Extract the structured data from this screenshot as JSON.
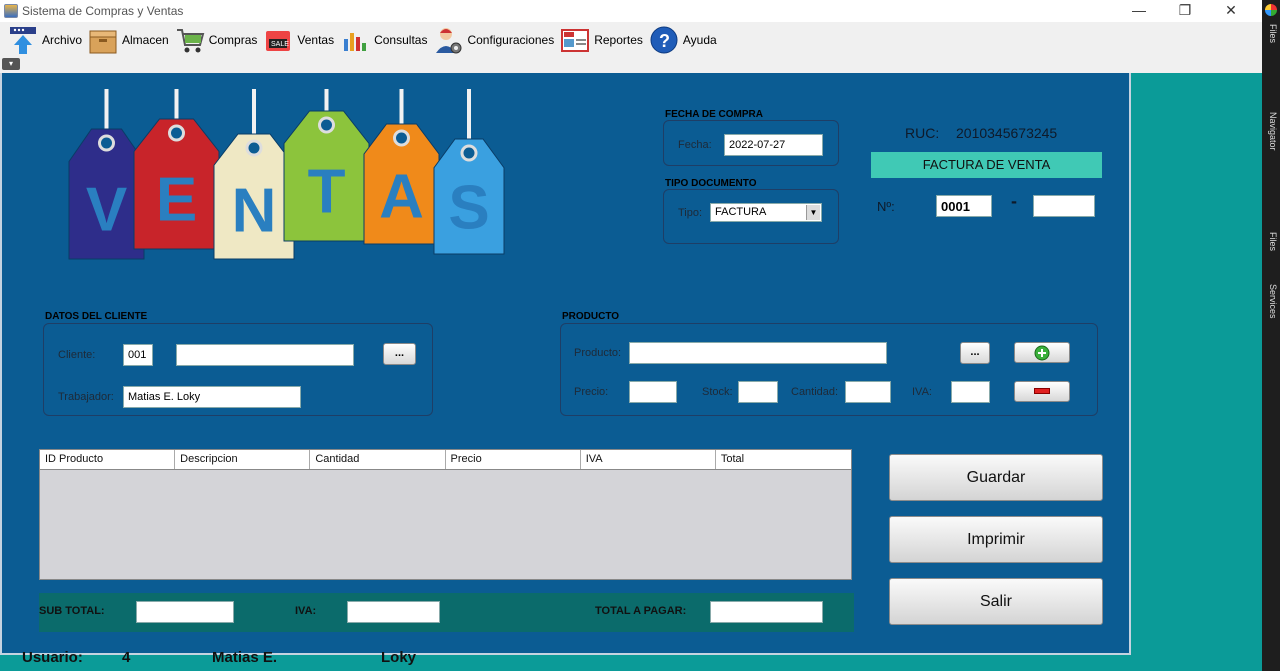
{
  "window": {
    "title": "Sistema de Compras y Ventas",
    "controls": [
      "—",
      "❐",
      "✕"
    ]
  },
  "menu": [
    {
      "label": "Archivo",
      "icon": "upload-icon"
    },
    {
      "label": "Almacen",
      "icon": "box-icon"
    },
    {
      "label": "Compras",
      "icon": "cart-icon"
    },
    {
      "label": "Ventas",
      "icon": "sale-icon"
    },
    {
      "label": "Consultas",
      "icon": "chart-icon"
    },
    {
      "label": "Configuraciones",
      "icon": "user-gear-icon"
    },
    {
      "label": "Reportes",
      "icon": "news-icon"
    },
    {
      "label": "Ayuda",
      "icon": "help-icon"
    }
  ],
  "ide_side": {
    "labels": [
      "Files",
      "Navigator",
      "Files",
      "Services"
    ]
  },
  "logo": {
    "text": "VENTAS",
    "letters": [
      "V",
      "E",
      "N",
      "T",
      "A",
      "S"
    ],
    "tag_colors": [
      "#2e2d8a",
      "#c8242a",
      "#efe8c4",
      "#8cc43c",
      "#f08a1a",
      "#3aa0e0"
    ]
  },
  "fecha": {
    "group_label": "FECHA DE COMPRA",
    "label": "Fecha:",
    "value": "2022-07-27"
  },
  "tipo": {
    "group_label": "TIPO DOCUMENTO",
    "label": "Tipo:",
    "value": "FACTURA"
  },
  "ruc": {
    "label": "RUC:",
    "value": "2010345673245"
  },
  "factura": {
    "title": "FACTURA DE VENTA",
    "num_label": "Nº:",
    "serie": "0001",
    "dash": "-",
    "numero": ""
  },
  "cliente": {
    "group_label": "DATOS DEL CLIENTE",
    "cliente_label": "Cliente:",
    "cliente_id": "001",
    "cliente_nombre": "",
    "browse_label": "...",
    "trabajador_label": "Trabajador:",
    "trabajador_value": "Matias E. Loky"
  },
  "producto": {
    "group_label": "PRODUCTO",
    "producto_label": "Producto:",
    "producto_value": "",
    "browse_label": "...",
    "precio_label": "Precio:",
    "stock_label": "Stock:",
    "cantidad_label": "Cantidad:",
    "iva_label": "IVA:"
  },
  "table": {
    "columns": [
      "ID Producto",
      "Descripcion",
      "Cantidad",
      "Precio",
      "IVA",
      "Total"
    ],
    "rows": []
  },
  "totals": {
    "subtotal_label": "SUB TOTAL:",
    "iva_label": "IVA:",
    "total_label": "TOTAL A PAGAR:"
  },
  "actions": {
    "guardar": "Guardar",
    "imprimir": "Imprimir",
    "salir": "Salir"
  },
  "status": {
    "usuario_label": "Usuario:",
    "id": "4",
    "nombre": "Matias E.",
    "apellido": "Loky"
  }
}
